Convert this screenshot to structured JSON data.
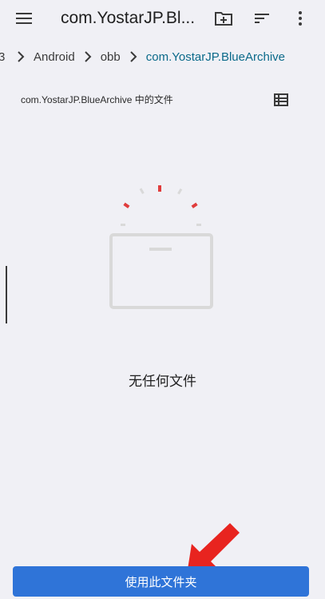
{
  "appbar": {
    "title": "com.YostarJP.Bl...",
    "menu_icon": "hamburger-menu-icon",
    "new_folder_icon": "new-folder-icon",
    "sort_icon": "sort-icon",
    "more_icon": "more-vert-icon"
  },
  "breadcrumb": {
    "items": [
      "3",
      "Android",
      "obb",
      "com.YostarJP.BlueArchive"
    ],
    "separator_icon": "chevron-right-icon"
  },
  "section": {
    "title": "com.YostarJP.BlueArchive 中的文件",
    "view_icon": "list-view-icon"
  },
  "empty_state": {
    "illustration_icon": "empty-folder-illustration",
    "message": "无任何文件"
  },
  "footer": {
    "button_label": "使用此文件夹"
  },
  "colors": {
    "accent": "#2f74d8",
    "breadcrumb_current": "#0b6a8a",
    "annotation": "#e8241f",
    "background": "#f0f0f5"
  }
}
